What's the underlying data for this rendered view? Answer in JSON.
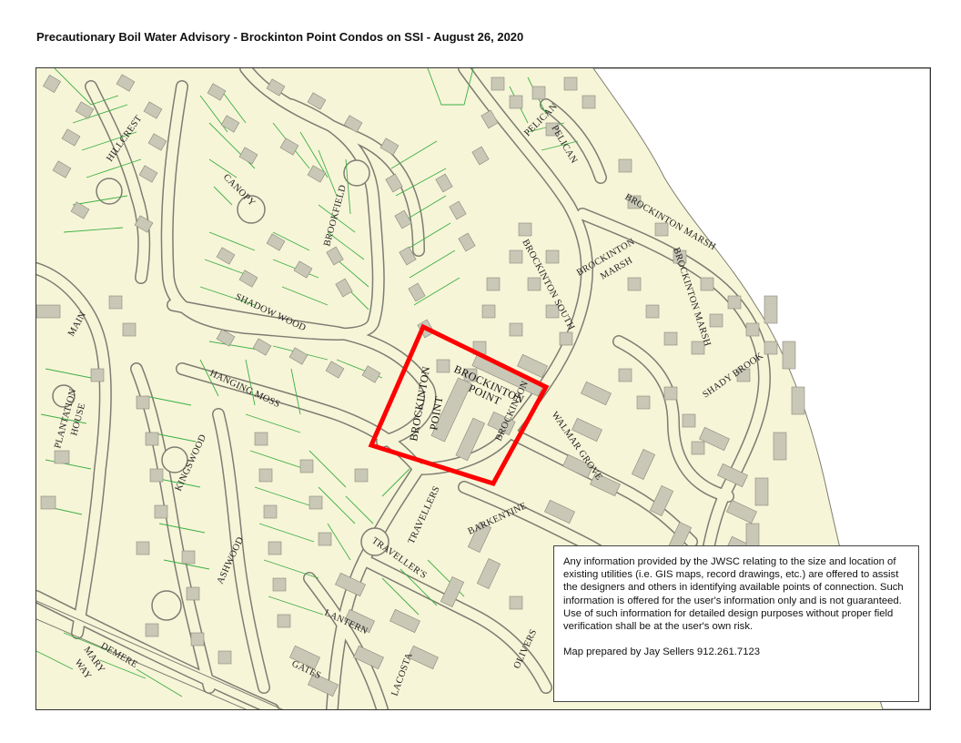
{
  "title": "Precautionary Boil Water Advisory - Brockinton Point Condos on SSI - August 26, 2020",
  "streets": {
    "hillcrest": "HILLCREST",
    "canopy": "CANOPY",
    "brookfield": "BROOKFIELD",
    "pelican_1": "PELICAN",
    "pelican_2": "PELICAN",
    "brockinton_marsh_1": "BROCKINTON MARSH",
    "brockinton_marsh_2a": "BROCKINTON",
    "brockinton_marsh_2b": "MARSH",
    "brockinton_marsh_3": "BROCKINTON MARSH",
    "brockinton_south": "BROCKINTON SOUTH",
    "shadow_wood": "SHADOW WOOD",
    "main": "MAIN",
    "hanging_moss": "HANGING MOSS",
    "plantation_house_1": "PLANTATION",
    "plantation_house_2": "HOUSE",
    "kingswood": "KINGSWOOD",
    "ashwood": "ASHWOOD",
    "shady_brook": "SHADY BROOK",
    "walmar_grove": "WALMAR GROVE",
    "travellers_1": "TRAVELLERS",
    "travellers_2": "TRAVELLER'S",
    "barkentine": "BARKENTINE",
    "lantern": "LANTERN",
    "gates": "GATES",
    "lacosta": "LACOSTA",
    "olivers": "OLIVERS",
    "demere": "DEMERE",
    "mary_1": "MARY",
    "mary_2": "WAY",
    "brockinton_partial": "BROCKINTON"
  },
  "condo": {
    "label_a1": "BROCKINTON",
    "label_a2": "POINT",
    "label_b1": "BROCKINTON",
    "label_b2": "POINT",
    "highlight_color": "#ff0000"
  },
  "disclaimer": {
    "text": "Any information provided by the JWSC relating to the size and location of existing utilities (i.e. GIS maps, record drawings, etc.) are offered to assist the designers and others in identifying available points of connection. Such information is offered for the user's information only and is not guaranteed. Use of such information for detailed design purposes without proper field verification shall be at the user's own risk.",
    "credit": "Map prepared by Jay Sellers 912.261.7123"
  },
  "colors": {
    "land": "#f7f5d8",
    "road_fill": "#f7f5d8",
    "road_edge": "#7d7d72",
    "parcel": "#3cb043",
    "building": "#c9c8b7",
    "marsh": "#ffffff"
  }
}
